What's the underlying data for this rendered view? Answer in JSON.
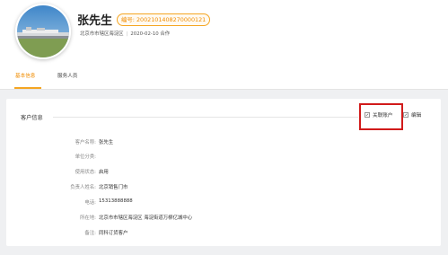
{
  "profile": {
    "name": "张先生",
    "code_badge": "编号: 2002101408270000121",
    "location": "北京市市辖区海淀区",
    "date_info": "2020-02-10 合作"
  },
  "tabs": [
    {
      "label": "基本信息",
      "active": true
    },
    {
      "label": "服务人员",
      "active": false
    }
  ],
  "card": {
    "title": "客户信息",
    "actions": {
      "link_account": "关联账户",
      "edit": "编辑"
    },
    "fields": [
      {
        "label": "客户名称:",
        "value": "张先生"
      },
      {
        "label": "单位分类:",
        "value": ""
      },
      {
        "label": "使用状态:",
        "value": "启用"
      },
      {
        "label": "负责人姓名:",
        "value": "北京销售门市"
      },
      {
        "label": "电话:",
        "value": "15313888888"
      },
      {
        "label": "所在地:",
        "value": "北京市市辖区海淀区 海淀街道万柳亿城中心"
      },
      {
        "label": "备注:",
        "value": "同科订货客户"
      }
    ]
  },
  "colors": {
    "accent": "#f5a623",
    "highlight": "#d11b1b"
  }
}
